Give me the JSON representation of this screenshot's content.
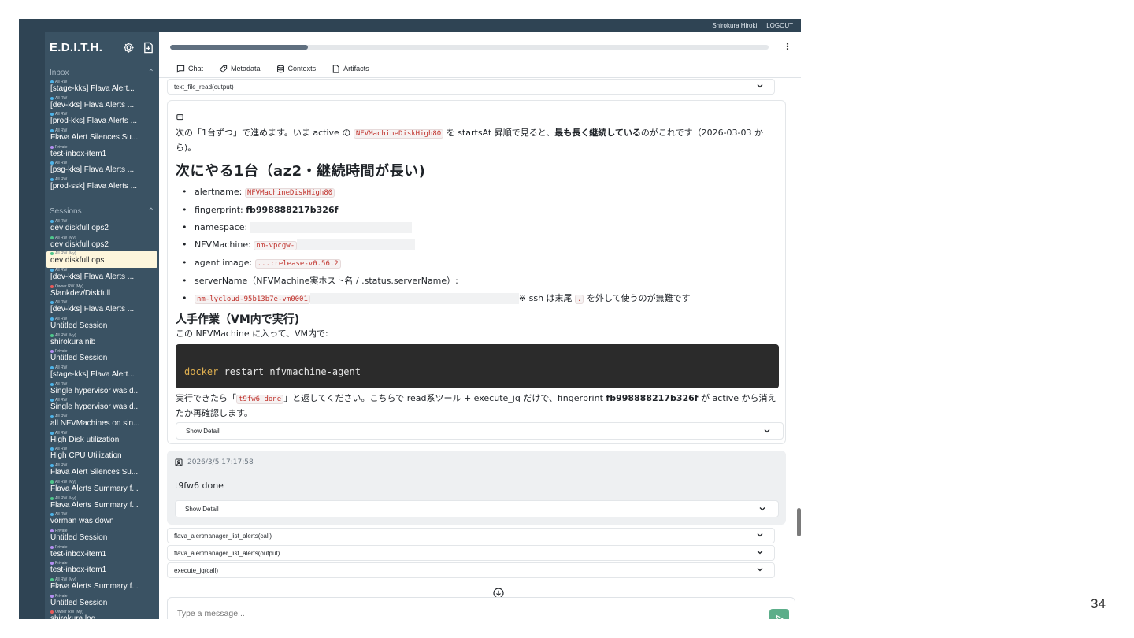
{
  "topbar": {
    "user": "Shirokura Hiroki",
    "logout": "LOGOUT"
  },
  "sidebar": {
    "brand": "E.D.I.T.H.",
    "inbox_label": "Inbox",
    "sessions_label": "Sessions",
    "inbox": [
      {
        "tag": "All RW",
        "title": "[stage-kks] Flava Alert...",
        "dot": "#4fb3e8"
      },
      {
        "tag": "All RW",
        "title": "[dev-kks] Flava Alerts ...",
        "dot": "#4fb3e8"
      },
      {
        "tag": "All RW",
        "title": "[prod-kks] Flava Alerts ...",
        "dot": "#4fb3e8"
      },
      {
        "tag": "All RW",
        "title": "Flava Alert Silences Su...",
        "dot": "#4fb3e8"
      },
      {
        "tag": "Private",
        "title": "test-inbox-item1",
        "dot": "#b48ef0"
      },
      {
        "tag": "All RW",
        "title": "[psg-kks] Flava Alerts ...",
        "dot": "#4fb3e8"
      },
      {
        "tag": "All RW",
        "title": "[prod-ssk] Flava Alerts ...",
        "dot": "#4fb3e8"
      }
    ],
    "sessions": [
      {
        "tag": "All RW",
        "title": "dev diskfull ops2",
        "dot": "#4fb3e8"
      },
      {
        "tag": "All RW (My)",
        "title": "dev diskfull ops2",
        "dot": "#4fc68b"
      },
      {
        "tag": "All RW (My)",
        "title": "dev diskfull ops",
        "dot": "#4fc68b",
        "active": true
      },
      {
        "tag": "All RW",
        "title": "[dev-kks] Flava Alerts ...",
        "dot": "#4fb3e8"
      },
      {
        "tag": "Owner RW (My)",
        "title": "Slankdev/Diskfull",
        "dot": "#e85a5a"
      },
      {
        "tag": "All RW",
        "title": "[dev-kks] Flava Alerts ...",
        "dot": "#4fb3e8"
      },
      {
        "tag": "All RW",
        "title": "Untitled Session",
        "dot": "#4fb3e8"
      },
      {
        "tag": "All RW (My)",
        "title": "shirokura nib",
        "dot": "#4fc68b"
      },
      {
        "tag": "Private",
        "title": "Untitled Session",
        "dot": "#b48ef0"
      },
      {
        "tag": "All RW",
        "title": "[stage-kks] Flava Alert...",
        "dot": "#4fb3e8"
      },
      {
        "tag": "All RW",
        "title": "Single hypervisor was d...",
        "dot": "#4fb3e8"
      },
      {
        "tag": "All RW",
        "title": "Single hypervisor was d...",
        "dot": "#4fb3e8"
      },
      {
        "tag": "All RW",
        "title": "all NFVMachines on sin...",
        "dot": "#4fb3e8"
      },
      {
        "tag": "All RW",
        "title": "High Disk utilization",
        "dot": "#4fb3e8"
      },
      {
        "tag": "All RW",
        "title": "High CPU Utilization",
        "dot": "#4fb3e8"
      },
      {
        "tag": "All RW",
        "title": "Flava Alert Silences Su...",
        "dot": "#4fb3e8"
      },
      {
        "tag": "All RW (My)",
        "title": "Flava Alerts Summary f...",
        "dot": "#4fc68b"
      },
      {
        "tag": "All RW (My)",
        "title": "Flava Alerts Summary f...",
        "dot": "#4fc68b"
      },
      {
        "tag": "All RW",
        "title": "vorman was down",
        "dot": "#4fb3e8"
      },
      {
        "tag": "Private",
        "title": "Untitled Session",
        "dot": "#b48ef0"
      },
      {
        "tag": "Private",
        "title": "test-inbox-item1",
        "dot": "#b48ef0"
      },
      {
        "tag": "Private",
        "title": "test-inbox-item1",
        "dot": "#b48ef0"
      },
      {
        "tag": "All RW (My)",
        "title": "Flava Alerts Summary f...",
        "dot": "#4fc68b"
      },
      {
        "tag": "Private",
        "title": "Untitled Session",
        "dot": "#b48ef0"
      },
      {
        "tag": "Owner RW (My)",
        "title": "shirokura log",
        "dot": "#e85a5a"
      }
    ]
  },
  "progress": {
    "fraction": 0.23
  },
  "tabs": [
    "Chat",
    "Metadata",
    "Contexts",
    "Artifacts"
  ],
  "chat": {
    "top_tool": "text_file_read(output)",
    "bot": {
      "intro_a": "次の「1台ずつ」で進めます。いま active の ",
      "intro_code": "NFVMachineDiskHigh80",
      "intro_b": " を startsAt 昇順で見ると、",
      "intro_bold": "最も長く継続している",
      "intro_c": "のがこれです（2026-03-03 から)。",
      "h2": "次にやる1台（az2・継続時間が長い)",
      "alertname_label": "alertname: ",
      "alertname_value": "NFVMachineDiskHigh80",
      "fingerprint_label": "fingerprint: ",
      "fingerprint_value": "fb998888217b326f",
      "namespace_label": "namespace: ",
      "nfvmachine_label": "NFVMachine: ",
      "nfvmachine_value": "nm-vpcgw-",
      "image_label": "agent image: ",
      "image_value": "...:release-v0.56.2",
      "servername_label": "serverName（NFVMachine実ホスト名 / .status.serverName）:",
      "servername_value": "nm-lycloud-95b13b7e-vm0001",
      "ssh_note_a": "※ ssh は末尾 ",
      "ssh_note_code": ".",
      "ssh_note_b": " を外して使うのが無難です",
      "h3": "人手作業（VM内で実行)",
      "h3_sub": "この NFVMachine に入って、VM内で:",
      "code_kw": "docker",
      "code_rest": " restart nfvmachine-agent",
      "outro_a": "実行できたら「",
      "outro_code": "t9fw6 done",
      "outro_b": "」と返してください。こちらで read系ツール + execute_jq だけで、fingerprint ",
      "outro_bold": "fb998888217b326f",
      "outro_c": " が active から消えたか再確認します。",
      "show_detail": "Show Detail"
    },
    "user": {
      "timestamp": "2026/3/5 17:17:58",
      "text": "t9fw6 done",
      "show_detail": "Show Detail"
    },
    "tools": [
      "flava_alertmanager_list_alerts(call)",
      "flava_alertmanager_list_alerts(output)",
      "execute_jq(call)"
    ]
  },
  "composer": {
    "placeholder": "Type a message..."
  },
  "page_number": "34"
}
